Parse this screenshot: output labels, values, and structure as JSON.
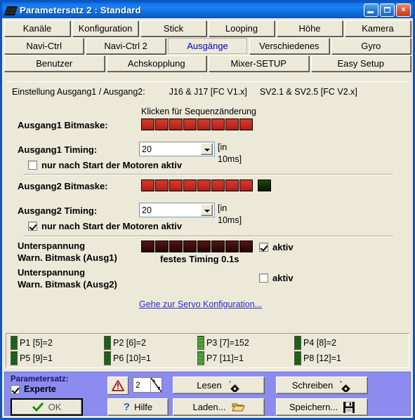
{
  "window": {
    "title": "Parametersatz 2 : Standard",
    "icon": "chip-icon",
    "buttons": {
      "minimize": "minimize-icon",
      "maximize": "maximize-icon",
      "close": "×"
    }
  },
  "tabs": {
    "row1": [
      {
        "label": "Kanäle",
        "selected": false
      },
      {
        "label": "Konfiguration",
        "selected": false
      },
      {
        "label": "Stick",
        "selected": false
      },
      {
        "label": "Looping",
        "selected": false
      },
      {
        "label": "Höhe",
        "selected": false
      },
      {
        "label": "Kamera",
        "selected": false
      }
    ],
    "row2": [
      {
        "label": "Navi-Ctrl",
        "selected": false
      },
      {
        "label": "Navi-Ctrl 2",
        "selected": false
      },
      {
        "label": "Ausgänge",
        "selected": true
      },
      {
        "label": "Verschiedenes",
        "selected": false
      },
      {
        "label": "Gyro",
        "selected": false
      }
    ],
    "row3": [
      {
        "label": "Benutzer",
        "selected": false
      },
      {
        "label": "Achskopplung",
        "selected": false
      },
      {
        "label": "Mixer-SETUP",
        "selected": false
      },
      {
        "label": "Easy Setup",
        "selected": false
      }
    ]
  },
  "panel": {
    "header": {
      "prefix": "Einstellung Ausgang1 / Ausgang2:",
      "mid": "J16 & J17 [FC V1.x]",
      "suffix": "SV2.1 & SV2.5 [FC V2.x]"
    },
    "click_hint": "Klicken für Sequenzänderung",
    "out1": {
      "bitmask_label": "Ausgang1 Bitmaske:",
      "bitmask": [
        "red",
        "red",
        "red",
        "red",
        "red",
        "red",
        "red",
        "red"
      ],
      "timing_label": "Ausgang1 Timing:",
      "timing_value": "20",
      "unit_line1": "[in",
      "unit_line2": "10ms]",
      "motor_label": "nur nach Start der Motoren aktiv",
      "motor_checked": false
    },
    "out2": {
      "bitmask_label": "Ausgang2 Bitmaske:",
      "bitmask": [
        "red",
        "red",
        "red",
        "red",
        "red",
        "red",
        "red",
        "red"
      ],
      "extra_cell": "green",
      "timing_label": "Ausgang2 Timing:",
      "timing_value": "20",
      "unit_line1": "[in",
      "unit_line2": "10ms]",
      "motor_label": "nur nach Start der Motoren aktiv",
      "motor_checked": true
    },
    "undervoltage1": {
      "label_line1": "Unterspannung",
      "label_line2": "Warn. Bitmask (Ausg1)",
      "bitmask": [
        "darkred",
        "darkred",
        "darkred",
        "darkred",
        "darkred",
        "darkred",
        "darkred",
        "darkred"
      ],
      "fixed_timing": "festes Timing 0.1s",
      "active_label": "aktiv",
      "active_checked": true
    },
    "undervoltage2": {
      "label_line1": "Unterspannung",
      "label_line2": "Warn. Bitmask (Ausg2)",
      "active_label": "aktiv",
      "active_checked": false
    },
    "servo_link": "Gehe zur Servo Konfiguration..."
  },
  "pvalues": [
    {
      "text": "P1 [5]=2",
      "bright": false
    },
    {
      "text": "P2 [6]=2",
      "bright": false
    },
    {
      "text": "P3 [7]=152",
      "bright": true
    },
    {
      "text": "P4 [8]=2",
      "bright": false
    },
    {
      "text": "P5 [9]=1",
      "bright": false
    },
    {
      "text": "P6 [10]=1",
      "bright": false
    },
    {
      "text": "P7 [11]=1",
      "bright": true
    },
    {
      "text": "P8 [12]=1",
      "bright": false
    }
  ],
  "bottom": {
    "paramset_label": "Parametersatz:",
    "expert_label": "Experte",
    "expert_checked": true,
    "ok_label": "OK",
    "warn_icon": "warning-triangle-icon",
    "spinner_value": "2",
    "help_label": "Hilfe",
    "read_label": "Lesen",
    "write_label": "Schreiben",
    "load_label": "Laden...",
    "save_label": "Speichern..."
  },
  "colors": {
    "titlebar": "#1e7ff0",
    "face": "#ece9d8",
    "bottom_bar": "#8c8cf0",
    "bit_red": "#c62b22",
    "bit_green": "#1d4a08",
    "bit_darkred": "#3a0d08",
    "link": "#2b2bd0",
    "tab_selected_text": "#0000c8"
  }
}
